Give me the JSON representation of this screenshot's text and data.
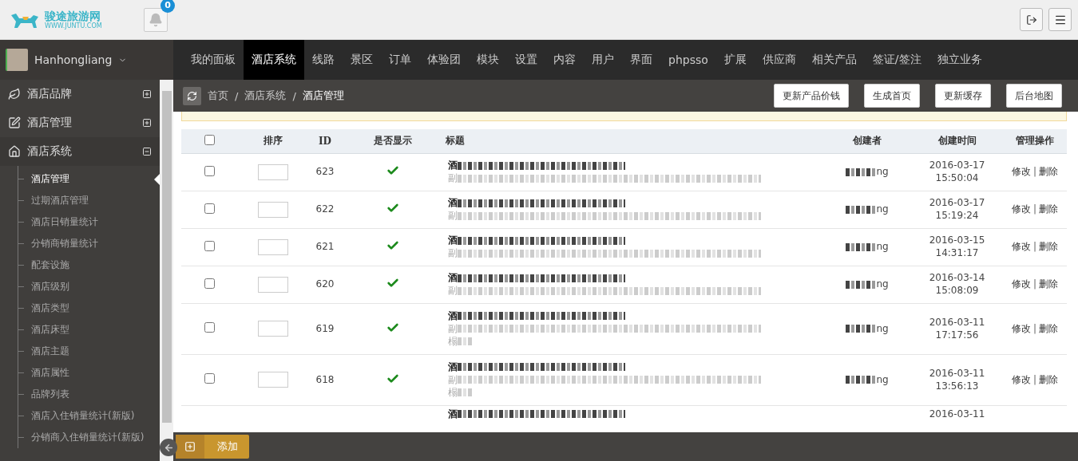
{
  "header": {
    "logo": {
      "name": "骏途旅游网",
      "url": "WWW.JUNTU.COM"
    },
    "notifications": {
      "count": "0"
    }
  },
  "user": {
    "name": "Hanhongliang"
  },
  "nav": [
    {
      "label": "我的面板",
      "selected": false
    },
    {
      "label": "酒店系统",
      "selected": true
    },
    {
      "label": "线路",
      "selected": false
    },
    {
      "label": "景区",
      "selected": false
    },
    {
      "label": "订单",
      "selected": false
    },
    {
      "label": "体验团",
      "selected": false
    },
    {
      "label": "模块",
      "selected": false
    },
    {
      "label": "设置",
      "selected": false
    },
    {
      "label": "内容",
      "selected": false
    },
    {
      "label": "用户",
      "selected": false
    },
    {
      "label": "界面",
      "selected": false
    },
    {
      "label": "phpsso",
      "selected": false
    },
    {
      "label": "扩展",
      "selected": false
    },
    {
      "label": "供应商",
      "selected": false
    },
    {
      "label": "相关产品",
      "selected": false
    },
    {
      "label": "签证/签注",
      "selected": false
    },
    {
      "label": "独立业务",
      "selected": false
    }
  ],
  "sidebar": {
    "groups": [
      {
        "label": "酒店品牌",
        "kind": "leaf",
        "expanded": false
      },
      {
        "label": "酒店管理",
        "kind": "edit",
        "expanded": false
      },
      {
        "label": "酒店系统",
        "kind": "home",
        "expanded": true,
        "children": [
          {
            "label": "酒店管理",
            "selected": true
          },
          {
            "label": "过期酒店管理",
            "selected": false
          },
          {
            "label": "酒店日销量统计",
            "selected": false
          },
          {
            "label": "分销商销量统计",
            "selected": false
          },
          {
            "label": "配套设施",
            "selected": false
          },
          {
            "label": "酒店级别",
            "selected": false
          },
          {
            "label": "酒店类型",
            "selected": false
          },
          {
            "label": "酒店床型",
            "selected": false
          },
          {
            "label": "酒店主题",
            "selected": false
          },
          {
            "label": "酒店属性",
            "selected": false
          },
          {
            "label": "品牌列表",
            "selected": false
          },
          {
            "label": "酒店入住销量统计(新版)",
            "selected": false
          },
          {
            "label": "分销商入住销量统计(新版)",
            "selected": false
          }
        ]
      }
    ]
  },
  "breadcrumb": [
    {
      "kind": "link",
      "text": "首页"
    },
    {
      "kind": "separator",
      "text": "/"
    },
    {
      "kind": "link",
      "text": "酒店系统"
    },
    {
      "kind": "separator",
      "text": "/"
    },
    {
      "kind": "current",
      "text": "酒店管理"
    }
  ],
  "actions": [
    "更新产品价钱",
    "生成首页",
    "更新缓存",
    "后台地图"
  ],
  "table": {
    "select_all_checked": false,
    "columns": [
      "排序",
      "ID",
      "是否显示",
      "标题",
      "创建者",
      "创建时间",
      "管理操作"
    ],
    "rows": [
      {
        "checked": false,
        "id": "623",
        "shown": true,
        "title_start": "酒",
        "subtitle_lines": [
          "副"
        ],
        "creator_end": "ng",
        "date": "2016-03-17",
        "time": "15:50:04",
        "edit": "修改",
        "separator": "|",
        "delete": "删除"
      },
      {
        "checked": false,
        "id": "622",
        "shown": true,
        "title_start": "酒",
        "subtitle_lines": [
          "副"
        ],
        "creator_end": "ng",
        "date": "2016-03-17",
        "time": "15:19:24",
        "edit": "修改",
        "separator": "|",
        "delete": "删除"
      },
      {
        "checked": false,
        "id": "621",
        "shown": true,
        "title_start": "酒",
        "subtitle_lines": [
          "副"
        ],
        "creator_end": "ng",
        "date": "2016-03-15",
        "time": "14:31:17",
        "edit": "修改",
        "separator": "|",
        "delete": "删除"
      },
      {
        "checked": false,
        "id": "620",
        "shown": true,
        "title_start": "酒",
        "subtitle_lines": [
          "副"
        ],
        "creator_end": "ng",
        "date": "2016-03-14",
        "time": "15:08:09",
        "edit": "修改",
        "separator": "|",
        "delete": "删除"
      },
      {
        "checked": false,
        "id": "619",
        "shown": true,
        "title_start": "酒",
        "subtitle_lines": [
          "副",
          "榻"
        ],
        "creator_end": "ng",
        "date": "2016-03-11",
        "time": "17:17:56",
        "edit": "修改",
        "separator": "|",
        "delete": "删除"
      },
      {
        "checked": false,
        "id": "618",
        "shown": true,
        "title_start": "酒",
        "subtitle_lines": [
          "副",
          "榻"
        ],
        "creator_end": "ng",
        "date": "2016-03-11",
        "time": "13:56:13",
        "edit": "修改",
        "separator": "|",
        "delete": "删除"
      },
      {
        "title_start": "酒",
        "date": "2016-03-11"
      }
    ]
  },
  "footer": {
    "add_button": "添加"
  }
}
